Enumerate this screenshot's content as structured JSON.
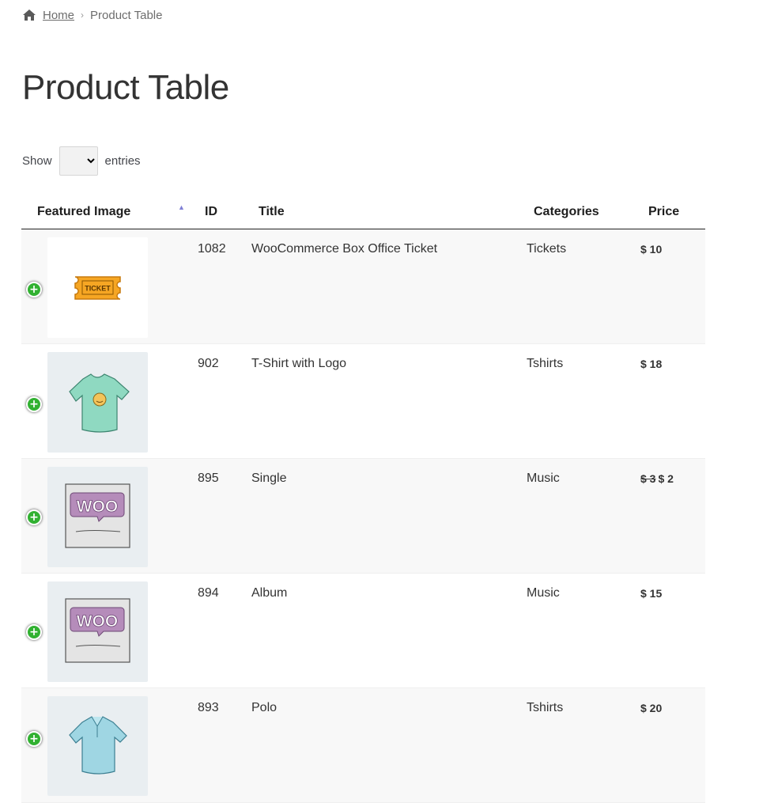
{
  "breadcrumb": {
    "home": "Home",
    "current": "Product Table"
  },
  "page": {
    "title": "Product Table"
  },
  "length": {
    "before": "Show",
    "after": "entries",
    "selected": ""
  },
  "table": {
    "columns": [
      "Featured Image",
      "ID",
      "Title",
      "Categories",
      "Price"
    ],
    "sort_indicator": "▲",
    "rows": [
      {
        "image": "ticket-image",
        "image_text": "TICKET",
        "id": "1082",
        "title": "WooCommerce Box Office Ticket",
        "category": "Tickets",
        "price": "$ 10",
        "old_price": ""
      },
      {
        "image": "tshirt-logo-image",
        "image_text": "",
        "id": "902",
        "title": "T-Shirt with Logo",
        "category": "Tshirts",
        "price": "$ 18",
        "old_price": ""
      },
      {
        "image": "woo-single-image",
        "image_text": "WOO",
        "id": "895",
        "title": "Single",
        "category": "Music",
        "price": "$ 2",
        "old_price": "$ 3"
      },
      {
        "image": "woo-album-image",
        "image_text": "WOO",
        "id": "894",
        "title": "Album",
        "category": "Music",
        "price": "$ 15",
        "old_price": ""
      },
      {
        "image": "polo-image",
        "image_text": "",
        "id": "893",
        "title": "Polo",
        "category": "Tshirts",
        "price": "$ 20",
        "old_price": ""
      }
    ]
  },
  "colors": {
    "expand": "#31b131",
    "sort": "#7f7fd5",
    "row_alt": "#f8f8f8"
  },
  "icons": {
    "home": "home-icon",
    "expand": "plus-circle-icon",
    "separator": "chevron-right-icon"
  }
}
